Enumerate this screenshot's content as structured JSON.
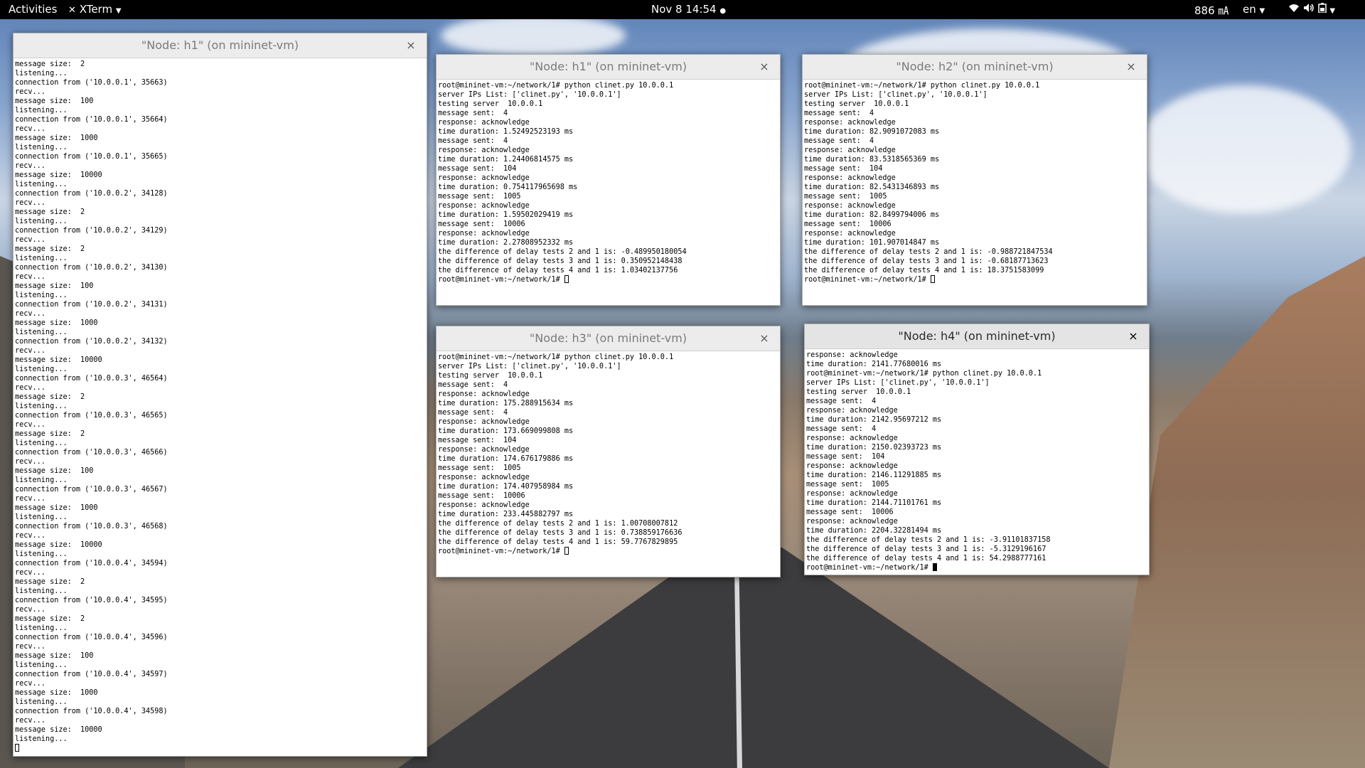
{
  "topbar": {
    "activities": "Activities",
    "app_name": "XTerm",
    "datetime": "Nov 8  14:54",
    "indicator": "886 ㎃",
    "language": "en"
  },
  "windows": {
    "h1_server": {
      "title": "\"Node: h1\" (on mininet-vm)",
      "lines": [
        "message size:  2",
        "listening...",
        "connection from ('10.0.0.1', 35663)",
        "recv...",
        "message size:  100",
        "listening...",
        "connection from ('10.0.0.1', 35664)",
        "recv...",
        "message size:  1000",
        "listening...",
        "connection from ('10.0.0.1', 35665)",
        "recv...",
        "message size:  10000",
        "listening...",
        "connection from ('10.0.0.2', 34128)",
        "recv...",
        "message size:  2",
        "listening...",
        "connection from ('10.0.0.2', 34129)",
        "recv...",
        "message size:  2",
        "listening...",
        "connection from ('10.0.0.2', 34130)",
        "recv...",
        "message size:  100",
        "listening...",
        "connection from ('10.0.0.2', 34131)",
        "recv...",
        "message size:  1000",
        "listening...",
        "connection from ('10.0.0.2', 34132)",
        "recv...",
        "message size:  10000",
        "listening...",
        "connection from ('10.0.0.3', 46564)",
        "recv...",
        "message size:  2",
        "listening...",
        "connection from ('10.0.0.3', 46565)",
        "recv...",
        "message size:  2",
        "listening...",
        "connection from ('10.0.0.3', 46566)",
        "recv...",
        "message size:  100",
        "listening...",
        "connection from ('10.0.0.3', 46567)",
        "recv...",
        "message size:  1000",
        "listening...",
        "connection from ('10.0.0.3', 46568)",
        "recv...",
        "message size:  10000",
        "listening...",
        "connection from ('10.0.0.4', 34594)",
        "recv...",
        "message size:  2",
        "listening...",
        "connection from ('10.0.0.4', 34595)",
        "recv...",
        "message size:  2",
        "listening...",
        "connection from ('10.0.0.4', 34596)",
        "recv...",
        "message size:  100",
        "listening...",
        "connection from ('10.0.0.4', 34597)",
        "recv...",
        "message size:  1000",
        "listening...",
        "connection from ('10.0.0.4', 34598)",
        "recv...",
        "message size:  10000",
        "listening..."
      ]
    },
    "h1_client": {
      "title": "\"Node: h1\" (on mininet-vm)",
      "lines": [
        "root@mininet-vm:~/network/1# python clinet.py 10.0.0.1",
        "server IPs List: ['clinet.py', '10.0.0.1']",
        "testing server  10.0.0.1",
        "message sent:  4",
        "response: acknowledge",
        "time duration: 1.52492523193 ms",
        "message sent:  4",
        "response: acknowledge",
        "time duration: 1.24406814575 ms",
        "message sent:  104",
        "response: acknowledge",
        "time duration: 0.754117965698 ms",
        "message sent:  1005",
        "response: acknowledge",
        "time duration: 1.59502029419 ms",
        "message sent:  10006",
        "response: acknowledge",
        "time duration: 2.27808952332 ms",
        "the difference of delay tests 2 and 1 is: -0.489950180054",
        "the difference of delay tests 3 and 1 is: 0.350952148438",
        "the difference of delay tests 4 and 1 is: 1.03402137756"
      ],
      "prompt": "root@mininet-vm:~/network/1# "
    },
    "h2_client": {
      "title": "\"Node: h2\" (on mininet-vm)",
      "lines": [
        "root@mininet-vm:~/network/1# python clinet.py 10.0.0.1",
        "server IPs List: ['clinet.py', '10.0.0.1']",
        "testing server  10.0.0.1",
        "message sent:  4",
        "response: acknowledge",
        "time duration: 82.9091072083 ms",
        "message sent:  4",
        "response: acknowledge",
        "time duration: 83.5318565369 ms",
        "message sent:  104",
        "response: acknowledge",
        "time duration: 82.5431346893 ms",
        "message sent:  1005",
        "response: acknowledge",
        "time duration: 82.8499794006 ms",
        "message sent:  10006",
        "response: acknowledge",
        "time duration: 101.907014847 ms",
        "the difference of delay tests 2 and 1 is: -0.988721847534",
        "the difference of delay tests 3 and 1 is: -0.68187713623",
        "the difference of delay tests 4 and 1 is: 18.3751583099"
      ],
      "prompt": "root@mininet-vm:~/network/1# "
    },
    "h3_client": {
      "title": "\"Node: h3\" (on mininet-vm)",
      "lines": [
        "root@mininet-vm:~/network/1# python clinet.py 10.0.0.1",
        "server IPs List: ['clinet.py', '10.0.0.1']",
        "testing server  10.0.0.1",
        "message sent:  4",
        "response: acknowledge",
        "time duration: 175.288915634 ms",
        "message sent:  4",
        "response: acknowledge",
        "time duration: 173.669099808 ms",
        "message sent:  104",
        "response: acknowledge",
        "time duration: 174.676179886 ms",
        "message sent:  1005",
        "response: acknowledge",
        "time duration: 174.407958984 ms",
        "message sent:  10006",
        "response: acknowledge",
        "time duration: 233.445882797 ms",
        "the difference of delay tests 2 and 1 is: 1.00708007812",
        "the difference of delay tests 3 and 1 is: 0.738859176636",
        "the difference of delay tests 4 and 1 is: 59.7767829895"
      ],
      "prompt": "root@mininet-vm:~/network/1# "
    },
    "h4_client": {
      "title": "\"Node: h4\" (on mininet-vm)",
      "lines": [
        "response: acknowledge",
        "time duration: 2141.77680016 ms",
        "root@mininet-vm:~/network/1# python clinet.py 10.0.0.1",
        "server IPs List: ['clinet.py', '10.0.0.1']",
        "testing server  10.0.0.1",
        "message sent:  4",
        "response: acknowledge",
        "time duration: 2142.95697212 ms",
        "message sent:  4",
        "response: acknowledge",
        "time duration: 2150.02393723 ms",
        "message sent:  104",
        "response: acknowledge",
        "time duration: 2146.11291885 ms",
        "message sent:  1005",
        "response: acknowledge",
        "time duration: 2144.71101761 ms",
        "message sent:  10006",
        "response: acknowledge",
        "time duration: 2204.32281494 ms",
        "the difference of delay tests 2 and 1 is: -3.91101837158",
        "the difference of delay tests 3 and 1 is: -5.3129196167",
        "the difference of delay tests 4 and 1 is: 54.2988777161"
      ],
      "prompt": "root@mininet-vm:~/network/1# "
    }
  },
  "close_glyph": "×"
}
